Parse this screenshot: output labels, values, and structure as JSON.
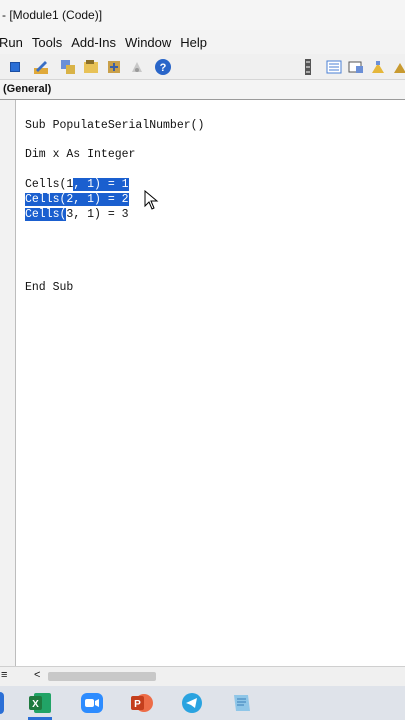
{
  "window": {
    "title": "- [Module1 (Code)]"
  },
  "menu": {
    "items": [
      {
        "label": "Run"
      },
      {
        "label": "Tools"
      },
      {
        "label": "Add-Ins"
      },
      {
        "label": "Window"
      },
      {
        "label": "Help"
      }
    ]
  },
  "toolbar": {
    "icons": [
      "reset-icon",
      "design-mode-icon",
      "project-explorer-icon",
      "properties-icon",
      "object-browser-icon",
      "toolbox-icon",
      "help-icon",
      "grip-icon",
      "indent-icon",
      "outdent-icon",
      "toggle-breakpoint-icon",
      "comment-icon"
    ]
  },
  "object_combo": {
    "value": "(General)"
  },
  "code": {
    "line1": "Sub PopulateSerialNumber()",
    "line2": "Dim x As Integer",
    "line3_pre": "Cells(1",
    "line3_sel": ", 1) = 1",
    "line4_sel": "Cells(2, 1) = 2",
    "line5_sel": "Cells(",
    "line5_post": "3, 1) = 3",
    "line6": "End Sub"
  },
  "scrollbar": {
    "left_glyph": "≡",
    "arrow_glyph": "<"
  },
  "taskbar": {
    "apps": [
      "excel-icon",
      "zoom-icon",
      "powerpoint-icon",
      "telegram-icon",
      "notepad-icon"
    ]
  },
  "colors": {
    "selection": "#1a5fcf",
    "excel": "#1f7a3f",
    "zoom": "#2d8cff",
    "powerpoint": "#d2492a",
    "telegram": "#2aa3e0"
  }
}
